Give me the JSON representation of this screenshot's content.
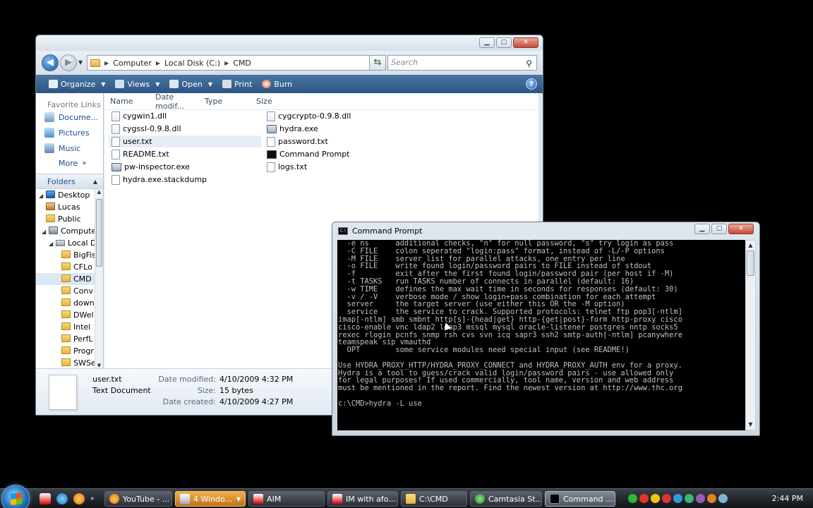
{
  "explorer": {
    "breadcrumb": [
      "Computer",
      "Local Disk (C:)",
      "CMD"
    ],
    "search_placeholder": "Search",
    "toolbar": {
      "organize": "Organize",
      "views": "Views",
      "open": "Open",
      "print": "Print",
      "burn": "Burn"
    },
    "nav": {
      "favorites_heading": "Favorite Links",
      "favorites": [
        "Docume...",
        "Pictures",
        "Music"
      ],
      "more": "More",
      "folders_heading": "Folders",
      "tree": [
        "Desktop",
        "Lucas",
        "Public",
        "Compute",
        "Local D",
        "BigFis",
        "CFLo",
        "CMD",
        "Conv",
        "down",
        "DWel",
        "Intel",
        "PerfL",
        "Progr",
        "SWSe"
      ]
    },
    "columns": [
      "Name",
      "Date modif...",
      "Type",
      "Size"
    ],
    "files_col1": [
      "cygwin1.dll",
      "cygssl-0.9.8.dll",
      "user.txt",
      "README.txt",
      "pw-inspector.exe",
      "hydra.exe.stackdump"
    ],
    "files_col2": [
      "cygcrypto-0.9.8.dll",
      "hydra.exe",
      "password.txt",
      "Command Prompt",
      "logs.txt"
    ],
    "details": {
      "name": "user.txt",
      "type": "Text Document",
      "date_modified_label": "Date modified:",
      "date_modified": "4/10/2009 4:32 PM",
      "size_label": "Size:",
      "size": "15 bytes",
      "date_created_label": "Date created:",
      "date_created": "4/10/2009 4:27 PM"
    }
  },
  "cmd": {
    "title": "Command Prompt",
    "lines": [
      "  -e ns      additional checks, \"n\" for null password, \"s\" try login as pass",
      "  -C FILE    colon seperated \"login:pass\" format, instead of -L/-P options",
      "  -M FILE    server list for parallel attacks, one entry per line",
      "  -o FILE    write found login/password pairs to FILE instead of stdout",
      "  -f         exit after the first found login/password pair (per host if -M)",
      "  -t TASKS   run TASKS number of connects in parallel (default: 16)",
      "  -w TIME    defines the max wait time in seconds for responses (default: 30)",
      "  -v / -V    verbose mode / show login+pass combination for each attempt",
      "  server     the target server (use either this OR the -M option)",
      "  service    the service to crack. Supported protocols: telnet ftp pop3[-ntlm]",
      "imap[-ntlm] smb smbnt http[s]-{head|get} http-{get|post}-form http-proxy cisco",
      "cisco-enable vnc ldap2 ldap3 mssql mysql oracle-listener postgres nntp socks5",
      "rexec rlogin pcnfs snmp rsh cvs svn icq sapr3 ssh2 smtp-auth[-ntlm] pcanywhere",
      "teamspeak sip vmauthd",
      "  OPT        some service modules need special input (see README!)",
      "",
      "Use HYDRA_PROXY_HTTP/HYDRA_PROXY_CONNECT and HYDRA_PROXY_AUTH env for a proxy.",
      "Hydra is a tool to guess/crack valid login/password pairs - use allowed only",
      "for legal purposes! If used commercially, tool name, version and web address",
      "must be mentioned in the report. Find the newest version at http://www.thc.org",
      "",
      "c:\\CMD>hydra -L use"
    ]
  },
  "taskbar": {
    "tasks": [
      "YouTube - ...",
      "4 Windo...",
      "AIM",
      "IM with afo...",
      "C:\\CMD",
      "Camtasia St...",
      "Command ..."
    ],
    "clock": "2:44 PM"
  },
  "colors": {
    "explorer_toolbar": "#2b5582",
    "console_bg": "#000000",
    "console_text": "#c0c0c0",
    "link_blue": "#1a4d8f"
  }
}
